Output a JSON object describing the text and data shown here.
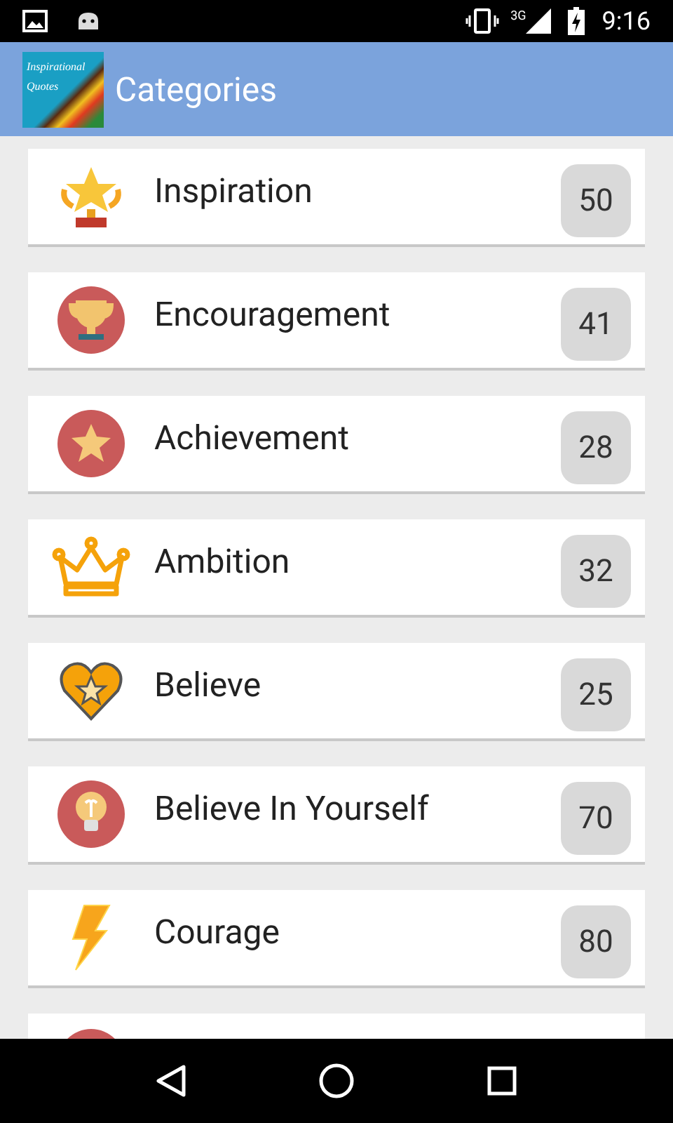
{
  "status_bar": {
    "network": "3G",
    "time": "9:16"
  },
  "app_bar": {
    "logo_lines": [
      "Inspirational",
      "Quotes"
    ],
    "title": "Categories"
  },
  "categories": [
    {
      "kind": "star-trophy",
      "name": "Inspiration",
      "count": "50"
    },
    {
      "kind": "cup-circle",
      "name": "Encouragement",
      "count": "41"
    },
    {
      "kind": "star-circle",
      "name": "Achievement",
      "count": "28"
    },
    {
      "kind": "crown",
      "name": "Ambition",
      "count": "32"
    },
    {
      "kind": "heart-star",
      "name": "Believe",
      "count": "25"
    },
    {
      "kind": "bulb-circle",
      "name": "Believe In Yourself",
      "count": "70"
    },
    {
      "kind": "bolt",
      "name": "Courage",
      "count": "80"
    }
  ],
  "partial_item": {
    "kind": "circle"
  }
}
